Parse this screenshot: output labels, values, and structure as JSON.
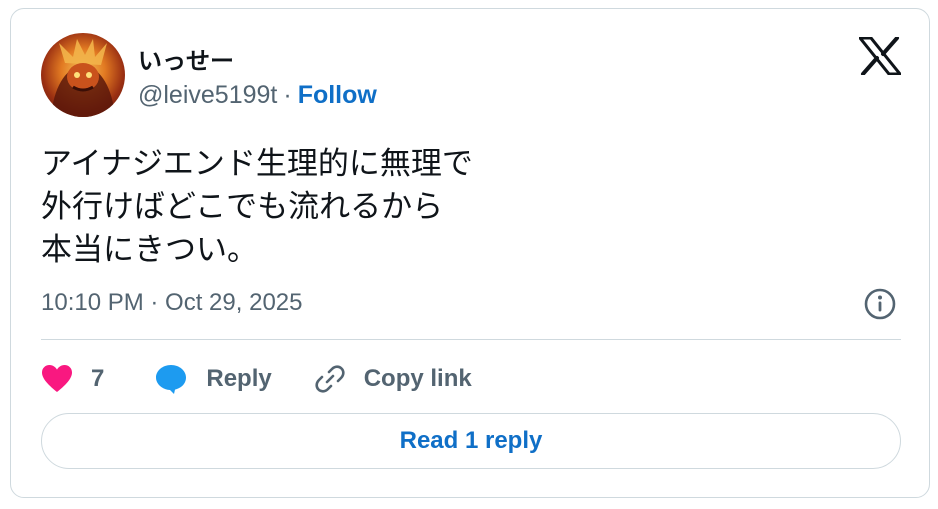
{
  "author": {
    "display_name": "いっせー",
    "handle": "@leive5199t",
    "separator": "·",
    "follow_label": "Follow"
  },
  "tweet": {
    "text": "アイナジエンド生理的に無理で\n外行けばどこでも流れるから\n本当にきつい。",
    "timestamp": "10:10 PM · Oct 29, 2025"
  },
  "actions": {
    "like_count": "7",
    "reply_label": "Reply",
    "copy_link_label": "Copy link"
  },
  "read_replies_label": "Read 1 reply",
  "colors": {
    "like": "#f91880",
    "reply": "#1d9bf0",
    "link": "#0f6fc7",
    "muted": "#536471",
    "border": "#cfd9de"
  },
  "icons": {
    "brand": "x-logo-icon",
    "info": "info-icon",
    "like": "heart-icon",
    "reply": "speech-bubble-icon",
    "copy": "link-icon"
  }
}
